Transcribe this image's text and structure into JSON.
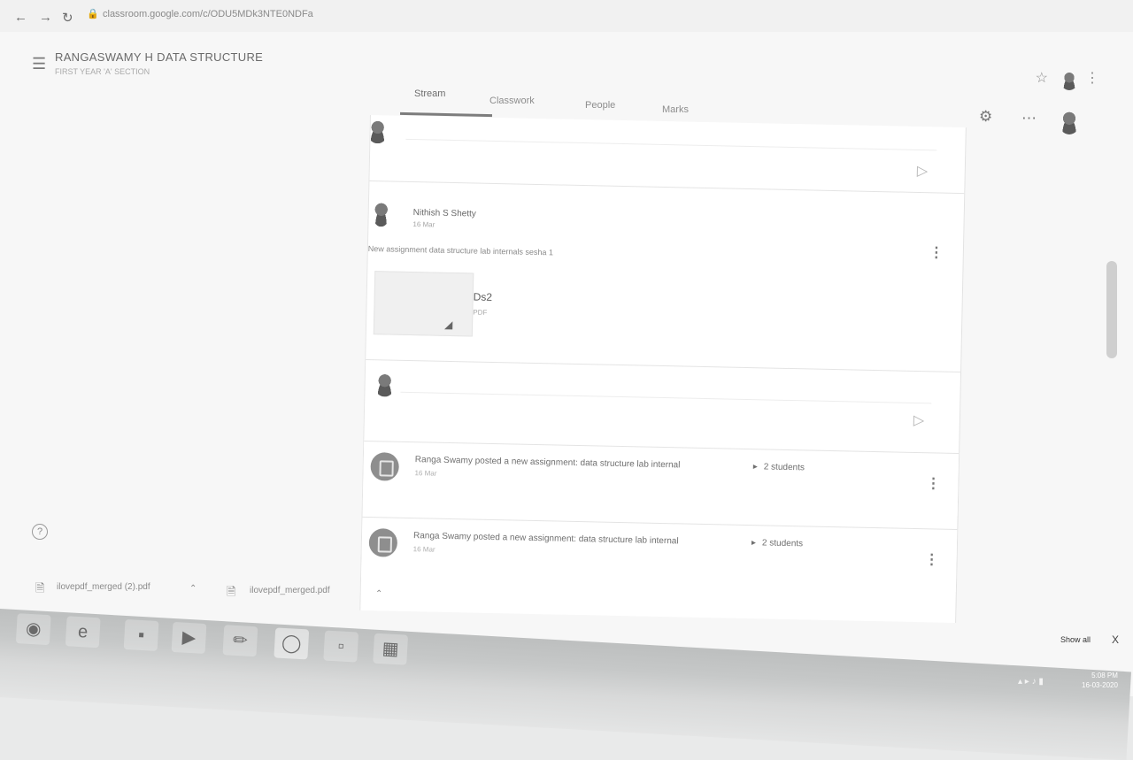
{
  "browser": {
    "nav_icons": [
      "back-icon",
      "forward-icon",
      "reload-icon"
    ],
    "url": "classroom.google.com/c/ODU5MDk3NTE0NDFa"
  },
  "header": {
    "title": "RANGASWAMY H DATA STRUCTURE",
    "subtitle": "FIRST YEAR 'A' SECTION",
    "tabs": [
      {
        "label": "Stream",
        "active": true
      },
      {
        "label": "Classwork",
        "active": false
      },
      {
        "label": "People",
        "active": false
      },
      {
        "label": "Marks",
        "active": false
      }
    ]
  },
  "stream": {
    "post": {
      "author": "Nithish S Shetty",
      "date": "16 Mar",
      "text": "New assignment data structure lab internals sesha 1",
      "attachment": {
        "name": "Ds2",
        "type": "PDF"
      }
    },
    "assignments": [
      {
        "text": "Ranga Swamy posted a new assignment: data structure lab internal",
        "students": "2 students",
        "date": "16 Mar"
      },
      {
        "text": "Ranga Swamy posted a new assignment: data structure lab internal",
        "students": "2 students",
        "date": "16 Mar"
      }
    ]
  },
  "downloads": {
    "items": [
      {
        "name": "ilovepdf_merged (2).pdf"
      },
      {
        "name": "ilovepdf_merged.pdf"
      }
    ],
    "show_all": "Show all",
    "close": "X"
  },
  "taskbar": {
    "time": "5:08 PM",
    "date": "16-03-2020"
  },
  "colors": {
    "accent": "#6d6d6d",
    "card_bg": "#ffffff",
    "taskbar": "#c6c8c8"
  }
}
